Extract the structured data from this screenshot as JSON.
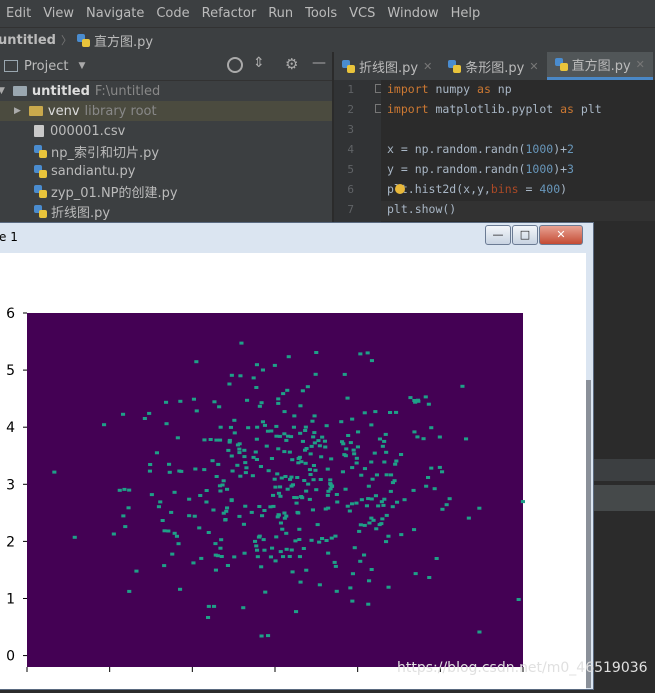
{
  "menu": [
    "Edit",
    "View",
    "Navigate",
    "Code",
    "Refactor",
    "Run",
    "Tools",
    "VCS",
    "Window",
    "Help"
  ],
  "breadcrumb": {
    "project": "untitled",
    "file": "直方图.py"
  },
  "project_panel": {
    "title": "Project",
    "root_name": "untitled",
    "root_path": "F:\\untitled",
    "venv_name": "venv",
    "venv_note": "library root",
    "files": [
      "000001.csv",
      "np_索引和切片.py",
      "sandiantu.py",
      "zyp_01.NP的创建.py",
      "折线图.py"
    ]
  },
  "tabs": [
    {
      "label": "折线图.py"
    },
    {
      "label": "条形图.py"
    },
    {
      "label": "直方图.py",
      "active": true
    }
  ],
  "editor": {
    "line_numbers": [
      "1",
      "2",
      "3",
      "4",
      "5",
      "6",
      "7"
    ],
    "lines": [
      {
        "kw": "import",
        "rest": " numpy ",
        "kw2": "as",
        "rest2": " np"
      },
      {
        "kw": "import",
        "rest": " matplotlib.pyplot ",
        "kw2": "as",
        "rest2": " plt"
      },
      {},
      {
        "a": "x = np.random.randn(",
        "n1": "1000",
        "b": ")+",
        "n2": "2"
      },
      {
        "a": "y = np.random.randn(",
        "n1": "1000",
        "b": ")+",
        "n2": "3"
      },
      {
        "a": "plt.hist2d(x,y,",
        "p": "bins",
        "b": " = ",
        "n1": "400",
        "c": ")"
      },
      {
        "a": "plt.show()"
      }
    ]
  },
  "figure_window": {
    "title": "e 1",
    "buttons": {
      "minimize": "—",
      "maximize": "□",
      "close": "✕"
    }
  },
  "chart_data": {
    "type": "heatmap",
    "description_of_values": "2D histogram of 1000 normal samples, 400 bins, mostly empty (dark purple) with sparse single-count bins",
    "x_range": [
      -1.2,
      4.8
    ],
    "y_range": [
      -0.2,
      6.0
    ],
    "y_ticks": [
      "0",
      "1",
      "2",
      "3",
      "4",
      "5",
      "6"
    ],
    "x_ticks": [
      "",
      "",
      "",
      "",
      "",
      "",
      ""
    ],
    "sample_count": 1000,
    "bins": 400,
    "x_mean": 2,
    "y_mean": 3,
    "background_color": "#440154",
    "point_color": "#1fa088"
  },
  "watermark": "https://blog.csdn.net/m0_46519036"
}
